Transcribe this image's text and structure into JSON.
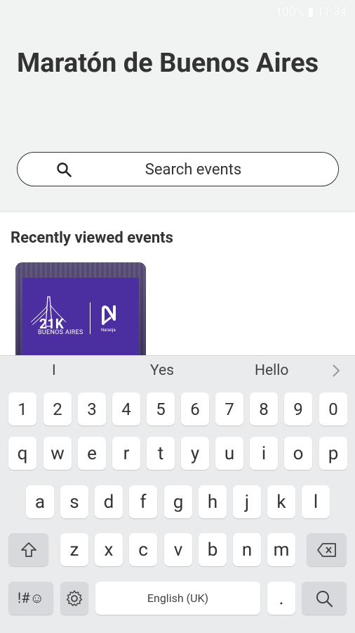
{
  "status_bar": {
    "text": "100% ▮ 11:34"
  },
  "header": {
    "title": "Maratón de Buenos Aires",
    "search_placeholder": "Search events"
  },
  "recent": {
    "section_title": "Recently viewed events",
    "card": {
      "logo_distance": "21K",
      "logo_city": "BUENOS AIRES",
      "sponsor": "Naranja"
    }
  },
  "keyboard": {
    "suggestions": [
      "I",
      "Yes",
      "Hello"
    ],
    "row_numbers": [
      "1",
      "2",
      "3",
      "4",
      "5",
      "6",
      "7",
      "8",
      "9",
      "0"
    ],
    "row_1": [
      "q",
      "w",
      "e",
      "r",
      "t",
      "y",
      "u",
      "i",
      "o",
      "p"
    ],
    "row_2": [
      "a",
      "s",
      "d",
      "f",
      "g",
      "h",
      "j",
      "k",
      "l"
    ],
    "row_3": [
      "z",
      "x",
      "c",
      "v",
      "b",
      "n",
      "m"
    ],
    "symbols_key": "!#☺",
    "space_label": "English (UK)",
    "period_key": "."
  }
}
